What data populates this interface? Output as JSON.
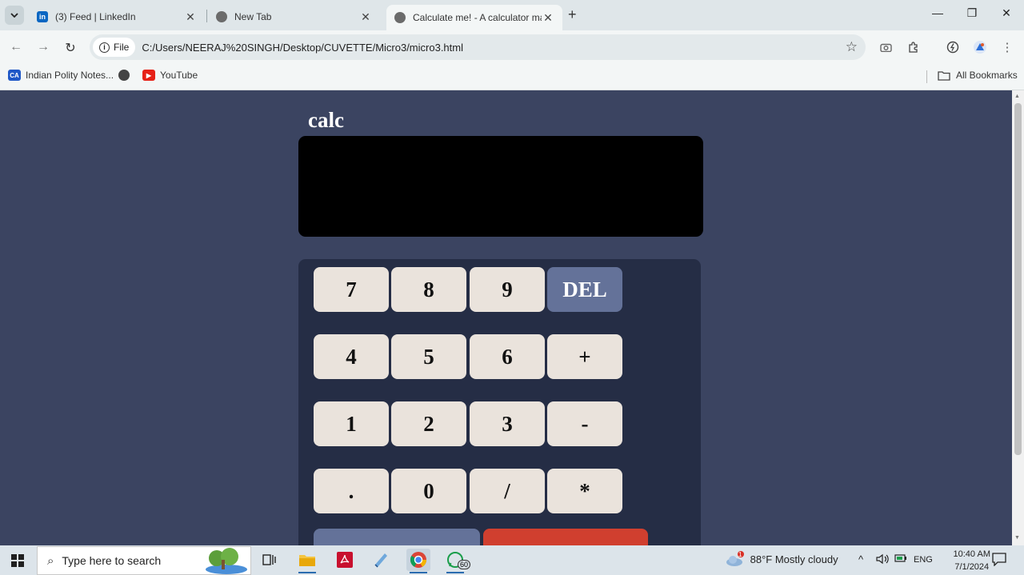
{
  "browser": {
    "tabs": [
      {
        "title": "(3) Feed | LinkedIn",
        "icon": "linkedin-icon"
      },
      {
        "title": "New Tab",
        "icon": "chrome-icon"
      },
      {
        "title": "Calculate me! - A calculator ma",
        "icon": "globe-icon",
        "active": true
      }
    ],
    "address": {
      "chip": "File",
      "url": "C:/Users/NEERAJ%20SINGH/Desktop/CUVETTE/Micro3/micro3.html"
    },
    "bookmarks": [
      {
        "label": "Indian Polity Notes...",
        "icon_text": "CA"
      },
      {
        "label": "",
        "icon": "globe-icon"
      },
      {
        "label": "YouTube",
        "icon": "youtube-icon"
      }
    ],
    "all_bookmarks": "All Bookmarks"
  },
  "calculator": {
    "title": "calc",
    "display_value": "",
    "keys": [
      {
        "label": "7"
      },
      {
        "label": "8"
      },
      {
        "label": "9"
      },
      {
        "label": "DEL"
      },
      {
        "label": "4"
      },
      {
        "label": "5"
      },
      {
        "label": "6"
      },
      {
        "label": "+"
      },
      {
        "label": "1"
      },
      {
        "label": "2"
      },
      {
        "label": "3"
      },
      {
        "label": "-"
      },
      {
        "label": "."
      },
      {
        "label": "0"
      },
      {
        "label": "/"
      },
      {
        "label": "*"
      }
    ]
  },
  "taskbar": {
    "search_placeholder": "Type here to search",
    "whatsapp_badge": "60",
    "weather_badge": "1",
    "weather": "88°F  Mostly cloudy",
    "language": "ENG",
    "time": "10:40 AM",
    "date": "7/1/2024"
  },
  "colors": {
    "page_bg": "#3b4461",
    "keypad_bg": "#252d45",
    "key_bg": "#eae3dc",
    "del_bg": "#647299",
    "equals_bg": "#d03f2f"
  }
}
